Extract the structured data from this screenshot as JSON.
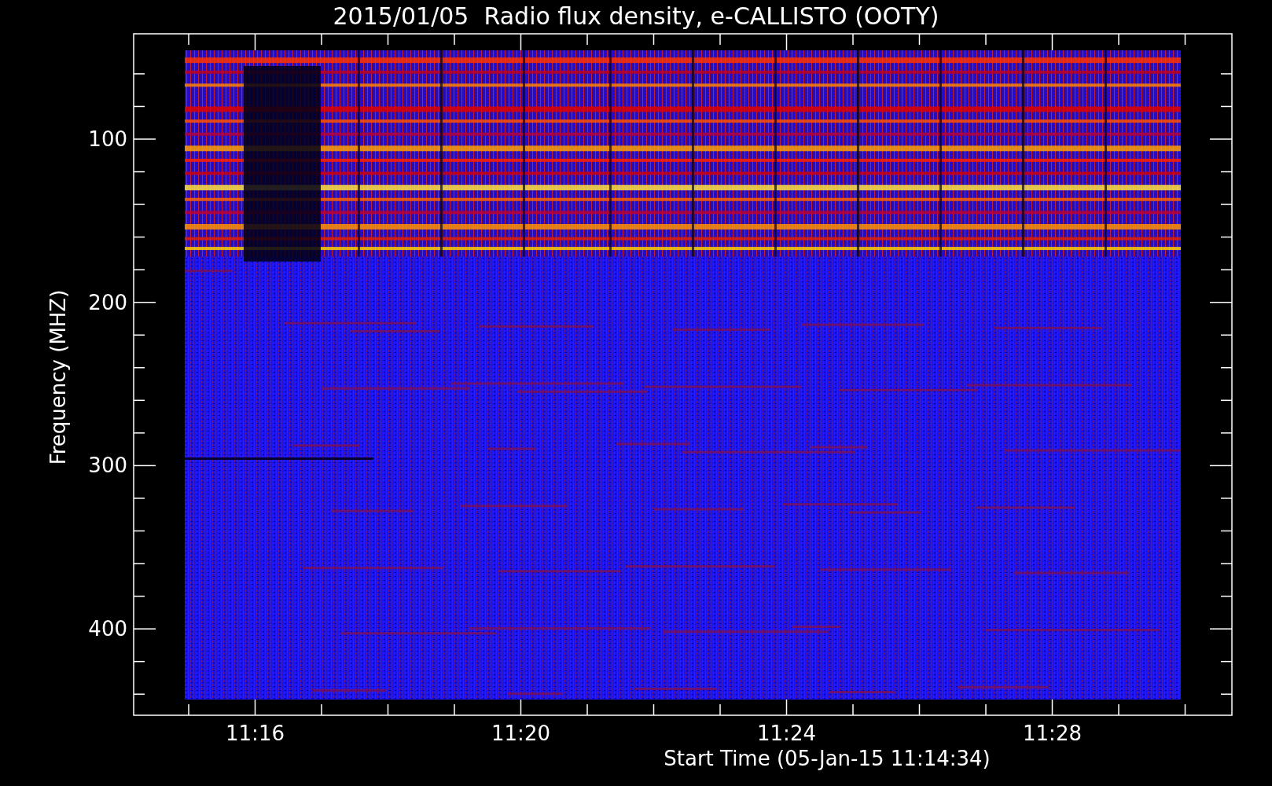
{
  "title": "2015/01/05  Radio flux density, e-CALLISTO (OOTY)",
  "y_axis": {
    "label": "Frequency (MHZ)",
    "ticks": [
      "100",
      "200",
      "300",
      "400"
    ]
  },
  "x_axis": {
    "label": "Start Time (05-Jan-15 11:14:34)",
    "ticks": [
      "11:16",
      "11:20",
      "11:24",
      "11:28"
    ]
  }
}
